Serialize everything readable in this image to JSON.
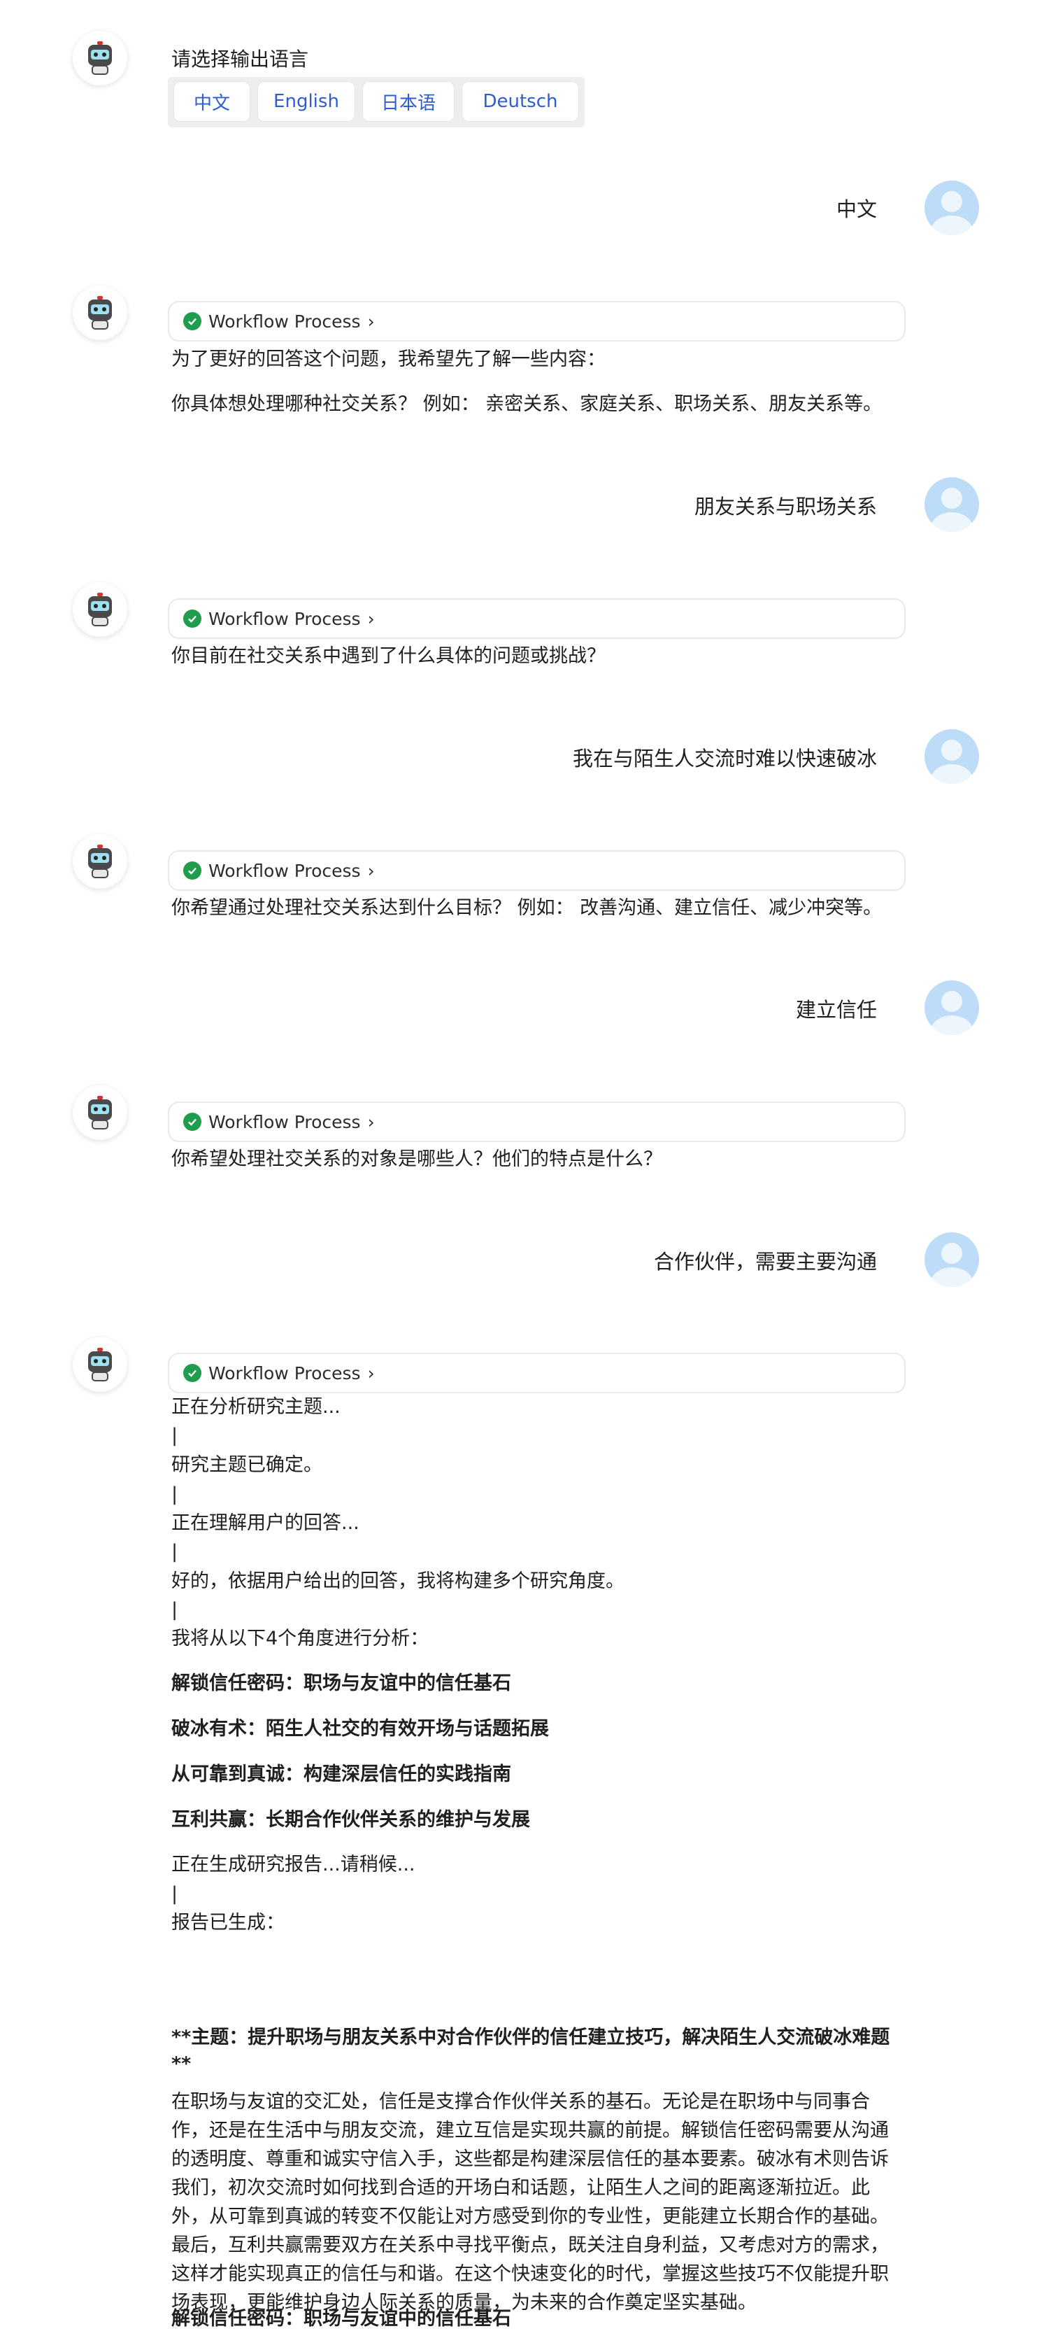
{
  "lang_prompt": {
    "title": "请选择输出语言",
    "options": [
      "中文",
      "English",
      "日本语",
      "Deutsch"
    ]
  },
  "workflow_label": "Workflow Process",
  "messages": {
    "u1": "中文",
    "b1_line1": "为了更好的回答这个问题，我希望先了解一些内容：",
    "b1_line2": "你具体想处理哪种社交关系？ 例如： 亲密关系、家庭关系、职场关系、朋友关系等。",
    "u2": "朋友关系与职场关系",
    "b2": "你目前在社交关系中遇到了什么具体的问题或挑战？",
    "u3": "我在与陌生人交流时难以快速破冰",
    "b3": "你希望通过处理社交关系达到什么目标？ 例如： 改善沟通、建立信任、减少冲突等。",
    "u4": "建立信任",
    "b4": "你希望处理社交关系的对象是哪些人？他们的特点是什么？",
    "u5": "合作伙伴，需要主要沟通"
  },
  "final": {
    "status1": "正在分析研究主题...",
    "sep": "|",
    "status2": "研究主题已确定。",
    "status3": "正在理解用户的回答...",
    "status4": "好的，依据用户给出的回答，我将构建多个研究角度。",
    "status5": "我将从以下4个角度进行分析：",
    "angles": [
      "解锁信任密码：职场与友谊中的信任基石",
      "破冰有术：陌生人社交的有效开场与话题拓展",
      "从可靠到真诚：构建深层信任的实践指南",
      "互利共赢：长期合作伙伴关系的维护与发展"
    ],
    "status6": "正在生成研究报告...请稍候...",
    "status7": "报告已生成：",
    "report_title": "**主题：提升职场与朋友关系中对合作伙伴的信任建立技巧，解决陌生人交流破冰难题**",
    "report_body": "在职场与友谊的交汇处，信任是支撑合作伙伴关系的基石。无论是在职场中与同事合作，还是在生活中与朋友交流，建立互信是实现共赢的前提。解锁信任密码需要从沟通的透明度、尊重和诚实守信入手，这些都是构建深层信任的基本要素。破冰有术则告诉我们，初次交流时如何找到合适的开场白和话题，让陌生人之间的距离逐渐拉近。此外，从可靠到真诚的转变不仅能让对方感受到你的专业性，更能建立长期合作的基础。最后，互利共赢需要双方在关系中寻找平衡点，既关注自身利益，又考虑对方的需求，这样才能实现真正的信任与和谐。在这个快速变化的时代，掌握这些技巧不仅能提升职场表现，更能维护身边人际关系的质量，为未来的合作奠定坚实基础。",
    "section1": "解锁信任密码：职场与友谊中的信任基石"
  }
}
